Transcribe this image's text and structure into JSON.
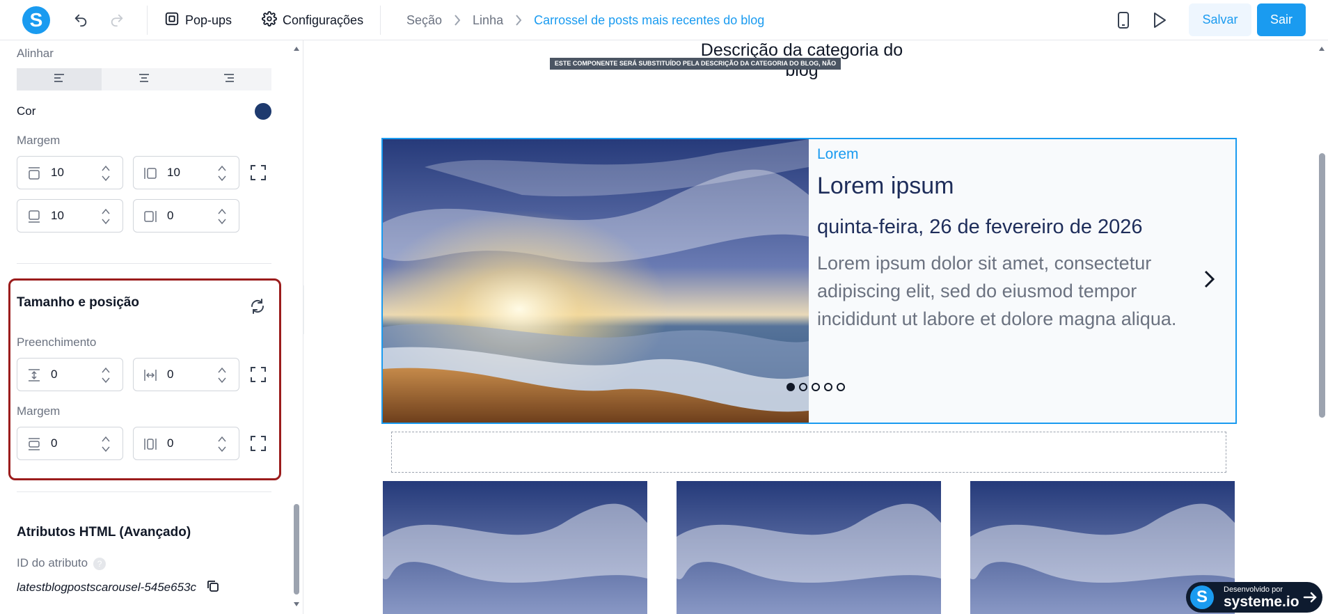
{
  "topbar": {
    "logo_letter": "S",
    "popups_label": "Pop-ups",
    "settings_label": "Configurações",
    "breadcrumbs": [
      "Seção",
      "Linha",
      "Carrossel de posts mais recentes do blog"
    ],
    "save_label": "Salvar",
    "exit_label": "Sair"
  },
  "panel": {
    "align_label": "Alinhar",
    "color_label": "Cor",
    "color_value": "#1e3a6e",
    "margin_label": "Margem",
    "margin": {
      "top": "10",
      "right": "10",
      "bottom": "10",
      "left": "0"
    },
    "size_section_title": "Tamanho e posição",
    "padding_label": "Preenchimento",
    "padding": {
      "vertical": "0",
      "horizontal": "0"
    },
    "margin2_label": "Margem",
    "margin2": {
      "vertical": "0",
      "horizontal": "0"
    },
    "html_section_title": "Atributos HTML (Avançado)",
    "attr_id_label": "ID do atributo",
    "help_glyph": "?",
    "attr_id_value": "latestblogpostscarousel-545e653c"
  },
  "canvas": {
    "category_description": "Descrição da categoria do blog",
    "category_tag": "ESTE COMPONENTE SERÁ SUBSTITUÍDO PELA DESCRIÇÃO DA CATEGORIA DO BLOG, NÃO REMOVA-O",
    "carousel": {
      "category": "Lorem",
      "title": "Lorem ipsum",
      "date": "quinta-feira, 26 de fevereiro de 2026",
      "body": "Lorem ipsum dolor sit amet, consectetur adipiscing elit, sed do eiusmod tempor incididunt ut labore et dolore magna aliqua.",
      "dots_total": 5,
      "active_dot": 1
    }
  },
  "badge": {
    "letter": "S",
    "line1": "Desenvolvido por",
    "line2": "systeme.io"
  },
  "colors": {
    "accent": "#1a9bf0",
    "highlight_border": "#9b1c1c",
    "title_navy": "#1e2d5a"
  }
}
